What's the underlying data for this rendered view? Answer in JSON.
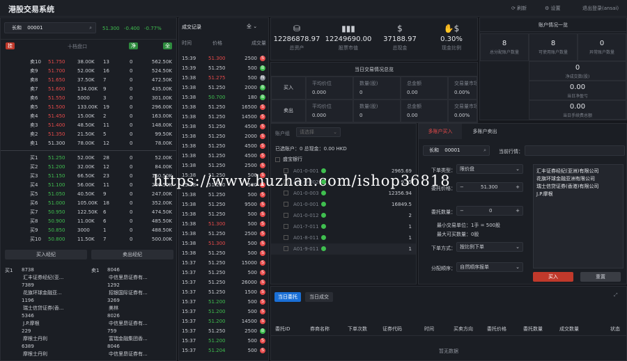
{
  "app": {
    "title": "港股交易系统",
    "refresh": "刷新",
    "settings": "设置",
    "logout": "退出登录(ansai)"
  },
  "quote": {
    "name": "长和",
    "code": "00001",
    "price": "51.300",
    "change": "-0.400",
    "pct": "-0.77%",
    "tag_left": "挂",
    "depth_label": "十档盘口",
    "tag_net": "净",
    "tag_all": "全"
  },
  "asks": [
    [
      "卖10",
      "51.750",
      "38.00K",
      "13",
      "0",
      "562.50K"
    ],
    [
      "卖9",
      "51.700",
      "52.00K",
      "16",
      "0",
      "524.50K"
    ],
    [
      "卖8",
      "51.650",
      "37.50K",
      "7",
      "0",
      "472.50K"
    ],
    [
      "卖7",
      "51.600",
      "134.00K",
      "9",
      "0",
      "435.00K"
    ],
    [
      "卖6",
      "51.550",
      "5000",
      "3",
      "0",
      "301.00K"
    ],
    [
      "卖5",
      "51.500",
      "133.00K",
      "19",
      "0",
      "296.00K"
    ],
    [
      "卖4",
      "51.450",
      "15.00K",
      "2",
      "0",
      "163.00K"
    ],
    [
      "卖3",
      "51.400",
      "48.50K",
      "11",
      "0",
      "148.00K"
    ],
    [
      "卖2",
      "51.350",
      "21.50K",
      "5",
      "0",
      "99.50K"
    ],
    [
      "卖1",
      "51.300",
      "78.00K",
      "12",
      "0",
      "78.00K"
    ]
  ],
  "bids": [
    [
      "买1",
      "51.250",
      "52.00K",
      "28",
      "0",
      "52.00K"
    ],
    [
      "买2",
      "51.200",
      "32.00K",
      "12",
      "0",
      "84.00K"
    ],
    [
      "买3",
      "51.150",
      "66.50K",
      "23",
      "0",
      "150.50K"
    ],
    [
      "买4",
      "51.100",
      "56.00K",
      "11",
      "0",
      "206.50K"
    ],
    [
      "买5",
      "51.050",
      "40.50K",
      "9",
      "0",
      "247.00K"
    ],
    [
      "买6",
      "51.000",
      "105.00K",
      "18",
      "0",
      "352.00K"
    ],
    [
      "买7",
      "50.950",
      "122.50K",
      "6",
      "0",
      "474.50K"
    ],
    [
      "买8",
      "50.900",
      "11.00K",
      "6",
      "0",
      "485.50K"
    ],
    [
      "买9",
      "50.850",
      "3000",
      "1",
      "0",
      "488.50K"
    ],
    [
      "买10",
      "50.800",
      "11.50K",
      "7",
      "0",
      "500.00K"
    ]
  ],
  "brokers": {
    "buy_title": "买入经纪",
    "sell_title": "卖出经纪",
    "buy": [
      [
        "买1",
        "8738",
        "汇丰证券经纪(亚..."
      ],
      [
        "",
        "7389",
        "花旗环球金融亚..."
      ],
      [
        "",
        "1196",
        "瑞士信贷证券(香..."
      ],
      [
        "",
        "5346",
        "J.P.摩根"
      ],
      [
        "",
        "229",
        "摩根士丹利"
      ],
      [
        "",
        "6389",
        "摩根士丹利"
      ]
    ],
    "sell": [
      [
        "卖1",
        "8046",
        "中信里昂证券有..."
      ],
      [
        "",
        "1292",
        "招银国际证券有..."
      ],
      [
        "",
        "3269",
        "美林"
      ],
      [
        "",
        "8026",
        "中信里昂证券有..."
      ],
      [
        "",
        "759",
        "富瑞金融集团香..."
      ],
      [
        "",
        "8046",
        "中信里昂证券有..."
      ]
    ]
  },
  "trades": {
    "title": "成交记录",
    "filter": "全",
    "cols": [
      "时间",
      "价格",
      "成交量"
    ],
    "rows": [
      [
        "15:39",
        "51.300",
        "2500",
        "S"
      ],
      [
        "15:39",
        "51.250",
        "500",
        "B"
      ],
      [
        "15:38",
        "51.275",
        "500",
        "N"
      ],
      [
        "15:38",
        "51.250",
        "2000",
        "B"
      ],
      [
        "15:38",
        "50.700",
        "180",
        "B"
      ],
      [
        "15:38",
        "51.250",
        "16500",
        "S"
      ],
      [
        "15:38",
        "51.250",
        "14500",
        "S"
      ],
      [
        "15:38",
        "51.250",
        "4500",
        "S"
      ],
      [
        "15:38",
        "51.250",
        "2000",
        "S"
      ],
      [
        "15:38",
        "51.250",
        "4500",
        "S"
      ],
      [
        "15:38",
        "51.250",
        "4500",
        "S"
      ],
      [
        "15:38",
        "51.250",
        "2500",
        "S"
      ],
      [
        "15:38",
        "51.250",
        "500",
        "S"
      ],
      [
        "15:38",
        "51.250",
        "500",
        "S"
      ],
      [
        "15:38",
        "51.250",
        "500",
        "S"
      ],
      [
        "15:38",
        "51.250",
        "9500",
        "S"
      ],
      [
        "15:38",
        "51.250",
        "500",
        "S"
      ],
      [
        "15:38",
        "51.300",
        "500",
        "S"
      ],
      [
        "15:38",
        "51.250",
        "2500",
        "S"
      ],
      [
        "15:38",
        "51.300",
        "500",
        "S"
      ],
      [
        "15:38",
        "51.250",
        "500",
        "S"
      ],
      [
        "15:37",
        "51.250",
        "15000",
        "S"
      ],
      [
        "15:37",
        "51.250",
        "500",
        "S"
      ],
      [
        "15:37",
        "51.250",
        "26000",
        "S"
      ],
      [
        "15:37",
        "51.250",
        "1500",
        "S"
      ],
      [
        "15:37",
        "51.200",
        "500",
        "S"
      ],
      [
        "15:37",
        "51.200",
        "500",
        "S"
      ],
      [
        "15:37",
        "51.200",
        "14500",
        "S"
      ],
      [
        "15:37",
        "51.250",
        "2500",
        "B"
      ],
      [
        "15:37",
        "51.200",
        "500",
        "S"
      ],
      [
        "15:37",
        "51.204",
        "500",
        "S"
      ]
    ]
  },
  "stats": [
    {
      "v": "12286878.97",
      "l": "总资产",
      "icon": "coins-icon"
    },
    {
      "v": "12249690.00",
      "l": "股票市值",
      "icon": "bar-chart-icon"
    },
    {
      "v": "37188.97",
      "l": "总现金",
      "icon": "cash-icon"
    },
    {
      "v": "0.30%",
      "l": "现金比例",
      "icon": "money-hand-icon"
    }
  ],
  "account_overview": {
    "title": "账户情况一览",
    "cells": [
      {
        "v": "8",
        "l": "总分配账户数量"
      },
      {
        "v": "8",
        "l": "可使用账户数量"
      },
      {
        "v": "0",
        "l": "异常账户数量"
      },
      {
        "v": "0",
        "l": "净成交数(股)"
      },
      {
        "v": "0.00",
        "l": "当日净盈亏"
      },
      {
        "v": "0.00",
        "l": "当日手续费总额"
      }
    ]
  },
  "today_summary": {
    "title": "当日交易情况总览",
    "buy": "买入",
    "sell": "卖出",
    "cols": [
      "平均价位",
      "数量(股)",
      "总金额",
      "交易量市场占比"
    ],
    "buy_vals": [
      "0.000",
      "0",
      "0.00",
      "0.00%"
    ],
    "sell_vals": [
      "0.000",
      "0",
      "0.00",
      "0.00%"
    ]
  },
  "accounts": {
    "group_label": "账户组",
    "group_placeholder": "请选择",
    "selected": "已选账户：0 总现金：0.00 HKD",
    "bank": "盛宝银行",
    "items": [
      [
        "A01-0-001",
        "2965.69"
      ],
      [
        "A01-0-002",
        "9.35"
      ],
      [
        "A01-0-003",
        "12356.94"
      ],
      [
        "A01-0-001",
        "16849.5"
      ],
      [
        "A01-0-012",
        "2"
      ],
      [
        "A01-7-011",
        "1"
      ],
      [
        "A01-8-011",
        "1"
      ],
      [
        "A01-9-011",
        "1"
      ]
    ]
  },
  "order": {
    "tab_buy": "多账户买入",
    "tab_sell": "多账户卖出",
    "stock_name": "长和",
    "stock_code": "00001",
    "current_quote": "当前行情：",
    "type_label": "下单类型：",
    "type_value": "限价盘",
    "price_label": "委托价格：",
    "price_value": "51.300",
    "qty_label": "委托数量：",
    "qty_value": "0",
    "min_unit": "最小交易单位：1手 = 500股",
    "max_buy": "最大可买数量：0股",
    "mode_label": "下单方式：",
    "mode_value": "按比例下单",
    "alloc_label": "分配顺序：",
    "alloc_value": "自然顺序报单",
    "brokers": [
      "汇丰证券经纪(亚洲)有限公司",
      "花旗环球金融亚洲有限公司",
      "瑞士信贷证券(香港)有限公司",
      "J.P.摩根"
    ],
    "buy_btn": "买入",
    "reset_btn": "重置"
  },
  "orders": {
    "tab_active": "当日委托",
    "tab_deals": "当日成交",
    "cols": [
      "委托ID",
      "券商名称",
      "下单次数",
      "证券代码",
      "时间",
      "买卖方向",
      "委托价格",
      "委托数量",
      "成交数量",
      "状态"
    ],
    "empty": "暂无数据"
  },
  "watermark": "https://www.huzhan.com/ishop36818",
  "colors": {
    "up": "#e84a4a",
    "down": "#3fbf4f",
    "accent": "#1a6fd6"
  }
}
